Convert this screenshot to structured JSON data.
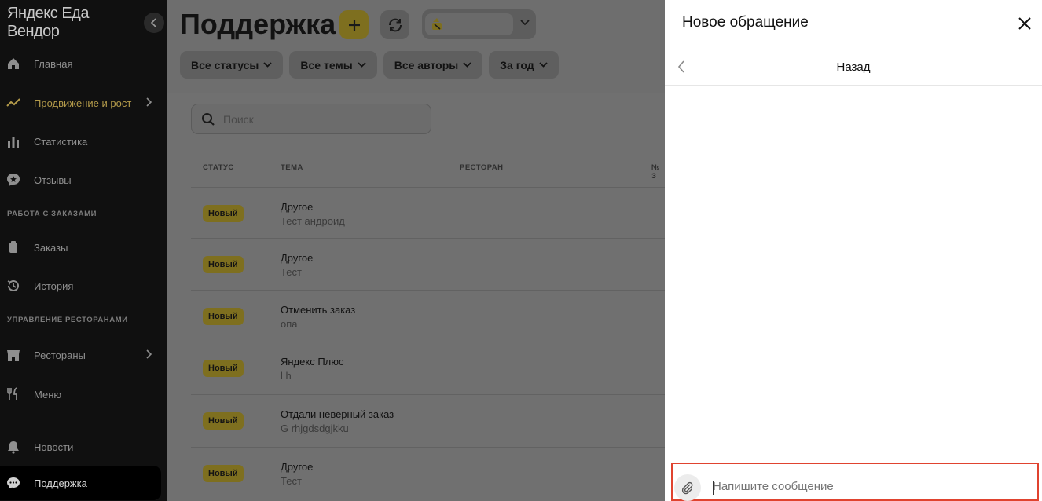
{
  "sidebar": {
    "logo": "Яндекс Еда Вендор",
    "items": [
      {
        "label": "Главная",
        "icon": "home-icon"
      },
      {
        "label": "Продвижение и рост",
        "icon": "trend-up-icon"
      },
      {
        "label": "Статистика",
        "icon": "bar-chart-icon"
      },
      {
        "label": "Отзывы",
        "icon": "reviews-icon"
      },
      {
        "label": "Заказы",
        "icon": "orders-icon"
      },
      {
        "label": "История",
        "icon": "history-icon"
      },
      {
        "label": "Рестораны",
        "icon": "store-icon"
      },
      {
        "label": "Меню",
        "icon": "fork-knife-icon"
      },
      {
        "label": "Новости",
        "icon": "bell-icon"
      },
      {
        "label": "Поддержка",
        "icon": "chat-icon"
      }
    ],
    "sections": [
      "РАБОТА С ЗАКАЗАМИ",
      "УПРАВЛЕНИЕ РЕСТОРАНАМИ"
    ]
  },
  "main": {
    "title": "Поддержка",
    "filters": [
      "Все статусы",
      "Все темы",
      "Все авторы",
      "За год"
    ],
    "search_placeholder": "Поиск",
    "columns": [
      "СТАТУС",
      "ТЕМА",
      "РЕСТОРАН",
      "№ З"
    ],
    "rows": [
      {
        "status": "Новый",
        "topic": "Другое",
        "sub": "Тест андроид"
      },
      {
        "status": "Новый",
        "topic": "Другое",
        "sub": "Тест"
      },
      {
        "status": "Новый",
        "topic": "Отменить заказ",
        "sub": "опа"
      },
      {
        "status": "Новый",
        "topic": "Яндекс Плюс",
        "sub": "l h"
      },
      {
        "status": "Новый",
        "topic": "Отдали неверный заказ",
        "sub": "G rhjgdsdgjkku"
      },
      {
        "status": "Новый",
        "topic": "Другое",
        "sub": "Тест"
      }
    ]
  },
  "panel": {
    "title": "Новое обращение",
    "back_label": "Назад",
    "message_placeholder": "Напишите сообщение"
  },
  "colors": {
    "accent_yellow": "#fce000",
    "highlight_border": "#e0432f"
  }
}
